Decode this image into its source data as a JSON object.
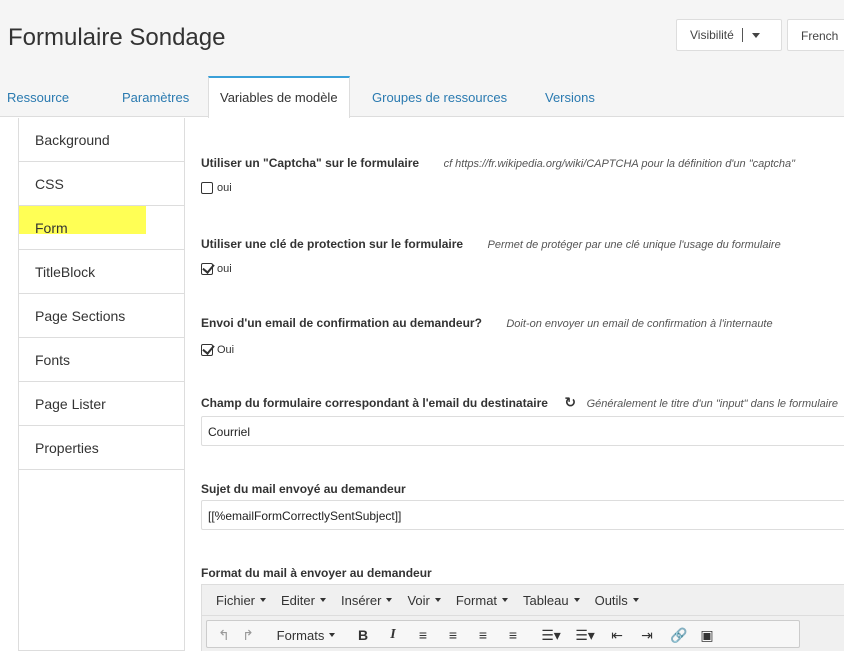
{
  "header": {
    "title": "Formulaire Sondage",
    "visibility_label": "Visibilité",
    "language_label": "French"
  },
  "tabs": [
    {
      "label": "Ressource"
    },
    {
      "label": "Paramètres"
    },
    {
      "label": "Variables de modèle"
    },
    {
      "label": "Groupes de ressources"
    },
    {
      "label": "Versions"
    }
  ],
  "sidebar": {
    "items": [
      {
        "label": "Background"
      },
      {
        "label": "CSS"
      },
      {
        "label": "Form"
      },
      {
        "label": "TitleBlock"
      },
      {
        "label": "Page Sections"
      },
      {
        "label": "Fonts"
      },
      {
        "label": "Page Lister"
      },
      {
        "label": "Properties"
      }
    ]
  },
  "fields": {
    "captcha": {
      "label": "Utiliser un \"Captcha\" sur le formulaire",
      "help": "cf https://fr.wikipedia.org/wiki/CAPTCHA pour la définition d'un \"captcha\"",
      "checkbox_label": "oui",
      "checked": false
    },
    "protection": {
      "label": "Utiliser une clé de protection sur le formulaire",
      "help": "Permet de protéger par une clé unique l'usage du formulaire",
      "checkbox_label": "oui",
      "checked": true
    },
    "confirmation": {
      "label": "Envoi d'un email de confirmation au demandeur?",
      "help": "Doit-on envoyer un email de confirmation à l'internaute",
      "checkbox_label": "Oui",
      "checked": true
    },
    "email_field": {
      "label": "Champ du formulaire correspondant à l'email du destinataire",
      "help": "Généralement le titre d'un \"input\" dans le formulaire",
      "value": "Courriel"
    },
    "subject": {
      "label": "Sujet du mail envoyé au demandeur",
      "value": "[[%emailFormCorrectlySentSubject]]"
    },
    "format": {
      "label": "Format du mail à envoyer au demandeur"
    }
  },
  "editor": {
    "menus": [
      "Fichier",
      "Editer",
      "Insérer",
      "Voir",
      "Format",
      "Tableau",
      "Outils"
    ],
    "formats_label": "Formats"
  }
}
